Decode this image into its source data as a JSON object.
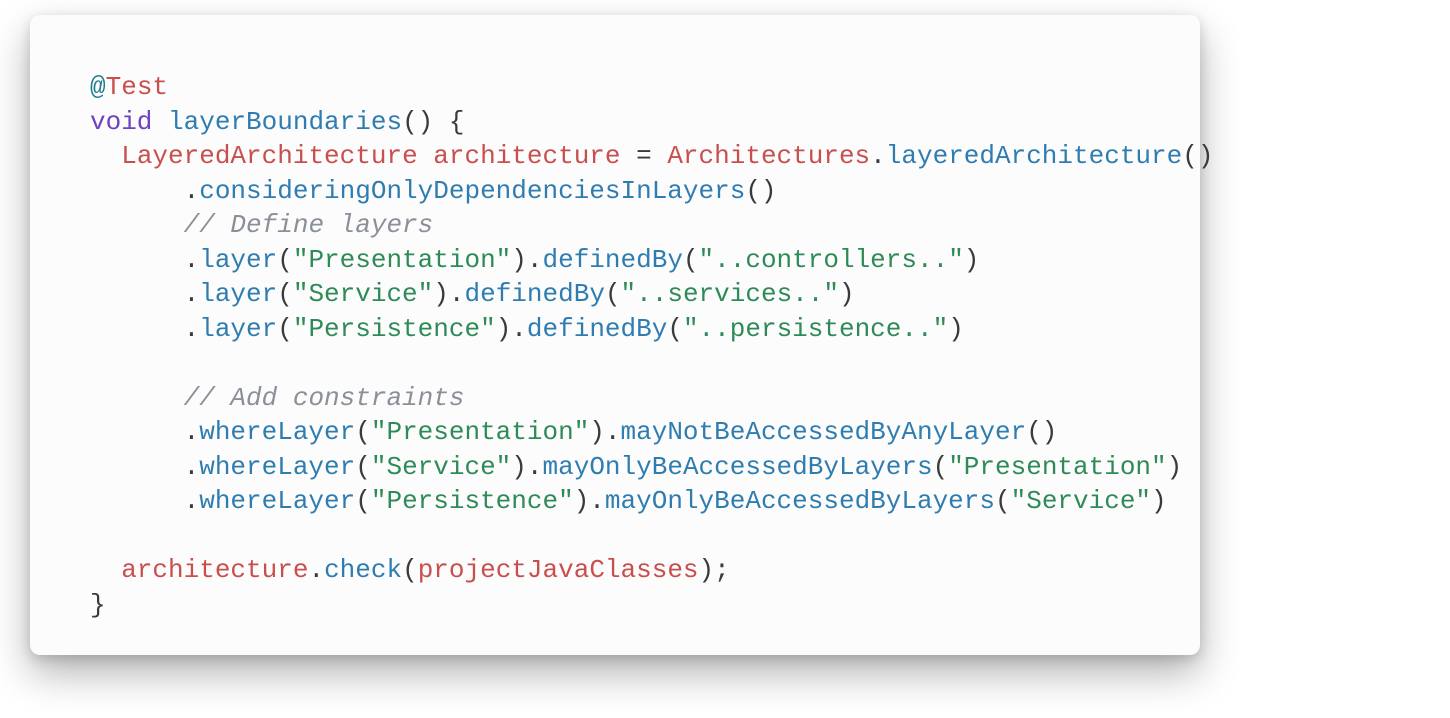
{
  "colors": {
    "annotation_at": "#1e7e8c",
    "annotation": "#c94f4f",
    "keyword": "#6f42c1",
    "method_decl": "#2f7db0",
    "type": "#c94f4f",
    "var": "#c94f4f",
    "method": "#2f7db0",
    "string": "#2e8b57",
    "comment": "#8a8f98",
    "punc": "#3a3a3a",
    "card_bg": "#fcfcfc"
  },
  "code": {
    "lines": [
      [
        {
          "cls": "annotation-at",
          "t": "@"
        },
        {
          "cls": "annotation",
          "t": "Test"
        }
      ],
      [
        {
          "cls": "keyword",
          "t": "void"
        },
        {
          "cls": "punc",
          "t": " "
        },
        {
          "cls": "method-decl",
          "t": "layerBoundaries"
        },
        {
          "cls": "punc",
          "t": "() {"
        }
      ],
      [
        {
          "cls": "punc",
          "t": "  "
        },
        {
          "cls": "type",
          "t": "LayeredArchitecture"
        },
        {
          "cls": "punc",
          "t": " "
        },
        {
          "cls": "var",
          "t": "architecture"
        },
        {
          "cls": "punc",
          "t": " = "
        },
        {
          "cls": "type",
          "t": "Architectures"
        },
        {
          "cls": "punc",
          "t": "."
        },
        {
          "cls": "method",
          "t": "layeredArchitecture"
        },
        {
          "cls": "punc",
          "t": "()"
        }
      ],
      [
        {
          "cls": "punc",
          "t": "      ."
        },
        {
          "cls": "method",
          "t": "consideringOnlyDependenciesInLayers"
        },
        {
          "cls": "punc",
          "t": "()"
        }
      ],
      [
        {
          "cls": "punc",
          "t": "      "
        },
        {
          "cls": "comment",
          "t": "// Define layers"
        }
      ],
      [
        {
          "cls": "punc",
          "t": "      ."
        },
        {
          "cls": "method",
          "t": "layer"
        },
        {
          "cls": "punc",
          "t": "("
        },
        {
          "cls": "string",
          "t": "\"Presentation\""
        },
        {
          "cls": "punc",
          "t": ")."
        },
        {
          "cls": "method",
          "t": "definedBy"
        },
        {
          "cls": "punc",
          "t": "("
        },
        {
          "cls": "string",
          "t": "\"..controllers..\""
        },
        {
          "cls": "punc",
          "t": ")"
        }
      ],
      [
        {
          "cls": "punc",
          "t": "      ."
        },
        {
          "cls": "method",
          "t": "layer"
        },
        {
          "cls": "punc",
          "t": "("
        },
        {
          "cls": "string",
          "t": "\"Service\""
        },
        {
          "cls": "punc",
          "t": ")."
        },
        {
          "cls": "method",
          "t": "definedBy"
        },
        {
          "cls": "punc",
          "t": "("
        },
        {
          "cls": "string",
          "t": "\"..services..\""
        },
        {
          "cls": "punc",
          "t": ")"
        }
      ],
      [
        {
          "cls": "punc",
          "t": "      ."
        },
        {
          "cls": "method",
          "t": "layer"
        },
        {
          "cls": "punc",
          "t": "("
        },
        {
          "cls": "string",
          "t": "\"Persistence\""
        },
        {
          "cls": "punc",
          "t": ")."
        },
        {
          "cls": "method",
          "t": "definedBy"
        },
        {
          "cls": "punc",
          "t": "("
        },
        {
          "cls": "string",
          "t": "\"..persistence..\""
        },
        {
          "cls": "punc",
          "t": ")"
        }
      ],
      [
        {
          "cls": "punc",
          "t": ""
        }
      ],
      [
        {
          "cls": "punc",
          "t": "      "
        },
        {
          "cls": "comment",
          "t": "// Add constraints"
        }
      ],
      [
        {
          "cls": "punc",
          "t": "      ."
        },
        {
          "cls": "method",
          "t": "whereLayer"
        },
        {
          "cls": "punc",
          "t": "("
        },
        {
          "cls": "string",
          "t": "\"Presentation\""
        },
        {
          "cls": "punc",
          "t": ")."
        },
        {
          "cls": "method",
          "t": "mayNotBeAccessedByAnyLayer"
        },
        {
          "cls": "punc",
          "t": "()"
        }
      ],
      [
        {
          "cls": "punc",
          "t": "      ."
        },
        {
          "cls": "method",
          "t": "whereLayer"
        },
        {
          "cls": "punc",
          "t": "("
        },
        {
          "cls": "string",
          "t": "\"Service\""
        },
        {
          "cls": "punc",
          "t": ")."
        },
        {
          "cls": "method",
          "t": "mayOnlyBeAccessedByLayers"
        },
        {
          "cls": "punc",
          "t": "("
        },
        {
          "cls": "string",
          "t": "\"Presentation\""
        },
        {
          "cls": "punc",
          "t": ")"
        }
      ],
      [
        {
          "cls": "punc",
          "t": "      ."
        },
        {
          "cls": "method",
          "t": "whereLayer"
        },
        {
          "cls": "punc",
          "t": "("
        },
        {
          "cls": "string",
          "t": "\"Persistence\""
        },
        {
          "cls": "punc",
          "t": ")."
        },
        {
          "cls": "method",
          "t": "mayOnlyBeAccessedByLayers"
        },
        {
          "cls": "punc",
          "t": "("
        },
        {
          "cls": "string",
          "t": "\"Service\""
        },
        {
          "cls": "punc",
          "t": ")"
        }
      ],
      [
        {
          "cls": "punc",
          "t": ""
        }
      ],
      [
        {
          "cls": "punc",
          "t": "  "
        },
        {
          "cls": "var",
          "t": "architecture"
        },
        {
          "cls": "punc",
          "t": "."
        },
        {
          "cls": "method",
          "t": "check"
        },
        {
          "cls": "punc",
          "t": "("
        },
        {
          "cls": "var",
          "t": "projectJavaClasses"
        },
        {
          "cls": "punc",
          "t": ");"
        }
      ],
      [
        {
          "cls": "punc",
          "t": "}"
        }
      ]
    ]
  }
}
